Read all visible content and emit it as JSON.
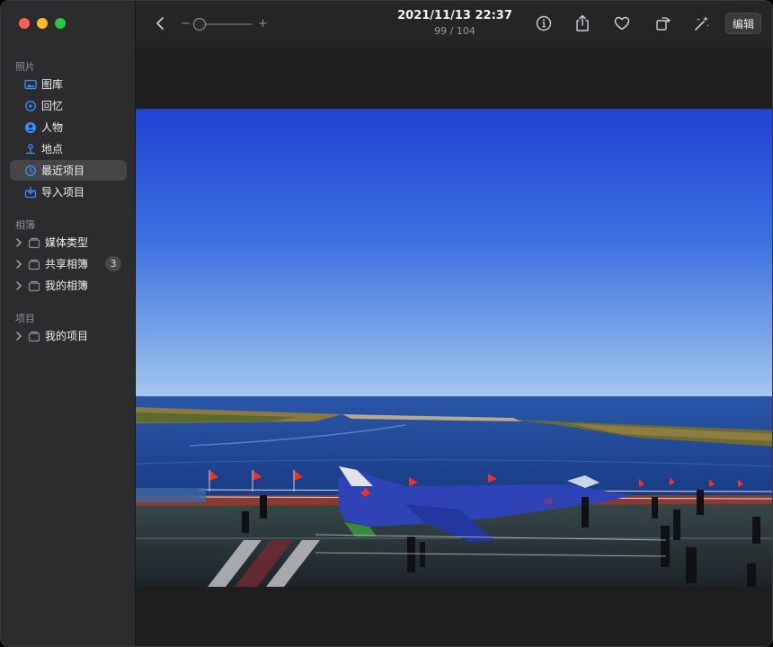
{
  "window": {
    "traffic_lights": [
      "close",
      "minimize",
      "zoom"
    ]
  },
  "sidebar": {
    "sections": [
      {
        "title": "照片",
        "items": [
          {
            "label": "图库",
            "icon": "photo-library-icon"
          },
          {
            "label": "回忆",
            "icon": "memories-icon"
          },
          {
            "label": "人物",
            "icon": "people-icon"
          },
          {
            "label": "地点",
            "icon": "places-icon"
          },
          {
            "label": "最近项目",
            "icon": "recents-clock-icon",
            "selected": true
          },
          {
            "label": "导入项目",
            "icon": "imports-icon"
          }
        ]
      },
      {
        "title": "相簿",
        "items": [
          {
            "label": "媒体类型",
            "icon": "album-folder-icon"
          },
          {
            "label": "共享相簿",
            "icon": "album-folder-icon",
            "badge": "3"
          },
          {
            "label": "我的相簿",
            "icon": "album-folder-icon"
          }
        ]
      },
      {
        "title": "项目",
        "items": [
          {
            "label": "我的项目",
            "icon": "album-folder-icon"
          }
        ]
      }
    ]
  },
  "toolbar": {
    "back_icon": "chevron-left-icon",
    "zoom_minus": "−",
    "zoom_plus": "+",
    "zoom_level": 0,
    "date": "2021/11/13 22:37",
    "count": "99 / 104",
    "edit_label": "编辑",
    "icons": [
      "info-icon",
      "share-icon",
      "favorite-heart-icon",
      "rotate-icon",
      "auto-enhance-wand-icon"
    ]
  },
  "colors": {
    "accent": "#3a8dff",
    "sidebar_bg": "#2c2c2e",
    "toolbar_bg": "#252527",
    "viewer_bg": "#1e1e1e"
  }
}
